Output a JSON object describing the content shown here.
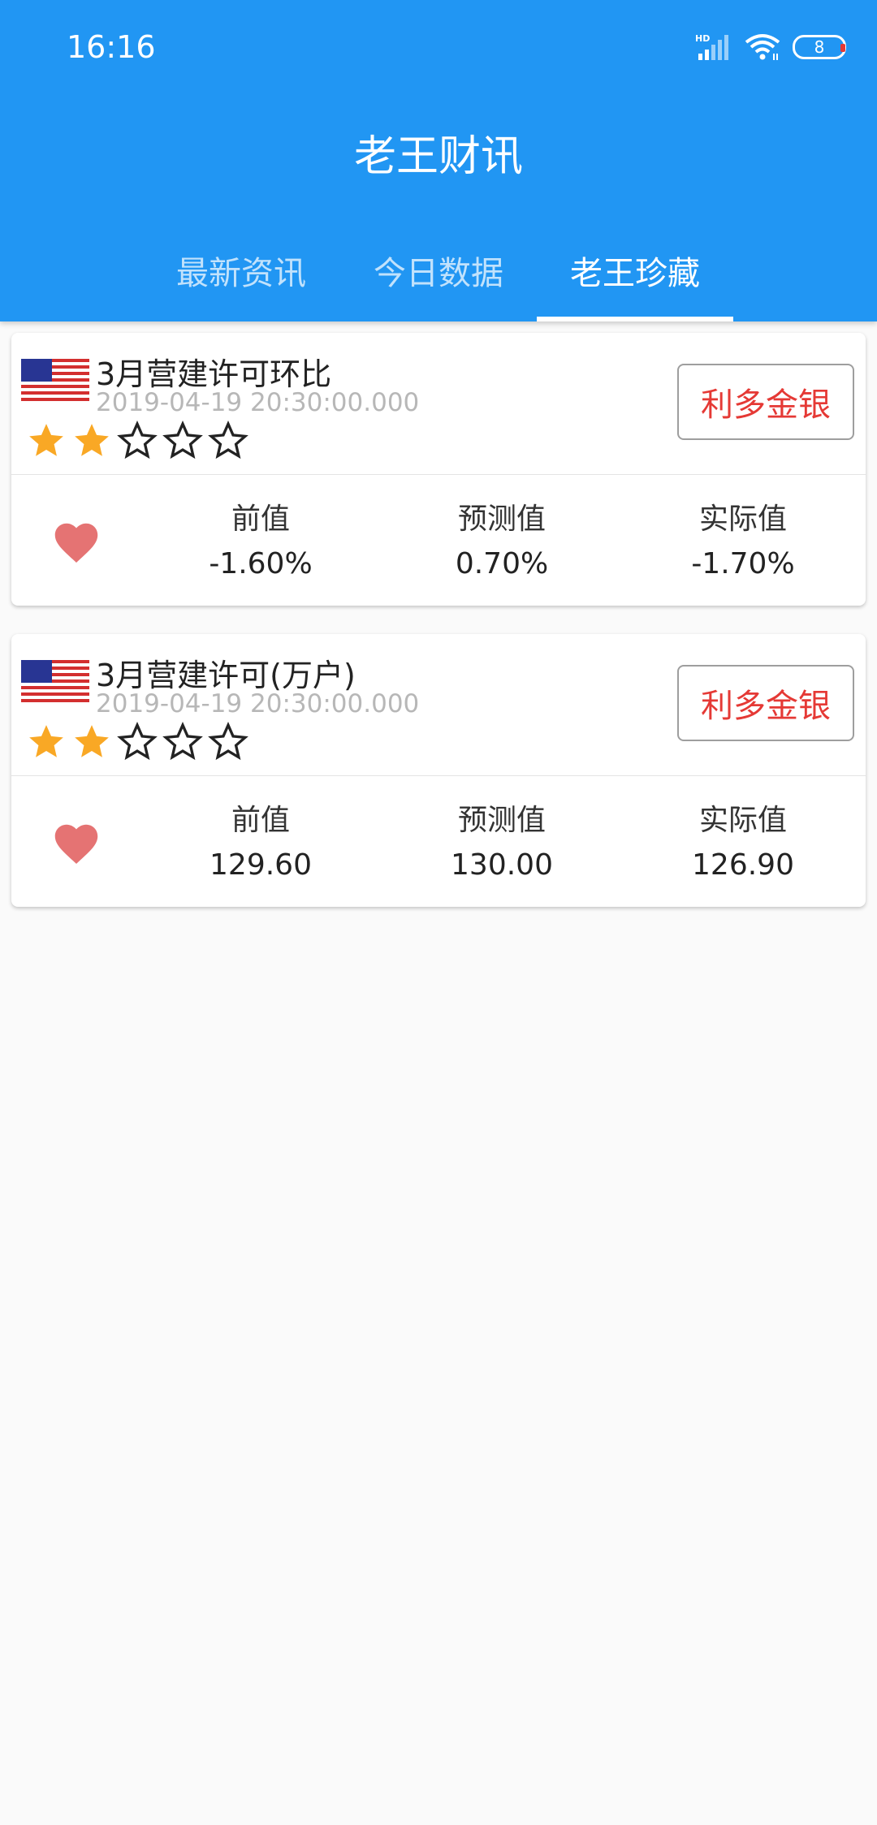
{
  "status_bar": {
    "time": "16:16",
    "battery_level": "8",
    "icons": [
      "hd-signal-icon",
      "wifi-icon",
      "battery-icon"
    ]
  },
  "app": {
    "title": "老王财讯"
  },
  "tabs": [
    {
      "label": "最新资讯",
      "active": false
    },
    {
      "label": "今日数据",
      "active": false
    },
    {
      "label": "老王珍藏",
      "active": true
    }
  ],
  "colors": {
    "primary": "#2196f3",
    "impact_text": "#e53935",
    "star": "#f9a825",
    "heart": "#e57373"
  },
  "items": [
    {
      "flag": "us-flag-icon",
      "title": "3月营建许可环比",
      "time": "2019-04-19 20:30:00.000",
      "stars_filled": 2,
      "stars_total": 5,
      "impact_label": "利多金银",
      "favorited": true,
      "previous_label": "前值",
      "previous_value": "-1.60%",
      "forecast_label": "预测值",
      "forecast_value": "0.70%",
      "actual_label": "实际值",
      "actual_value": "-1.70%"
    },
    {
      "flag": "us-flag-icon",
      "title": "3月营建许可(万户)",
      "time": "2019-04-19 20:30:00.000",
      "stars_filled": 2,
      "stars_total": 5,
      "impact_label": "利多金银",
      "favorited": true,
      "previous_label": "前值",
      "previous_value": "129.60",
      "forecast_label": "预测值",
      "forecast_value": "130.00",
      "actual_label": "实际值",
      "actual_value": "126.90"
    }
  ]
}
